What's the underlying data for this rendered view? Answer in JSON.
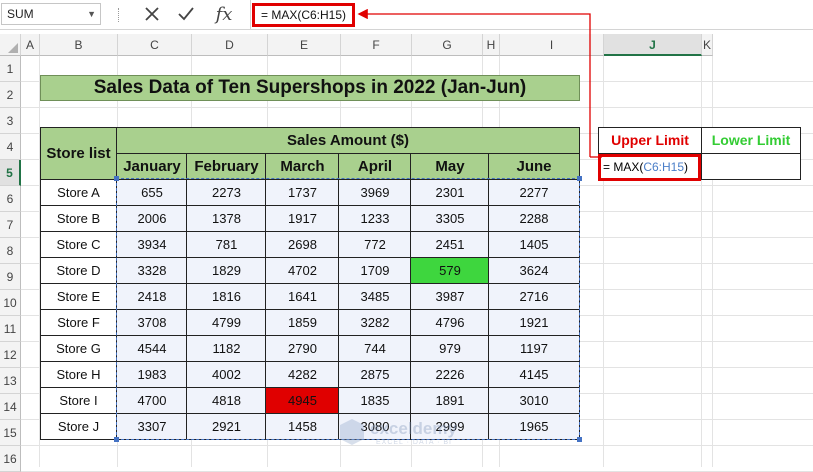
{
  "formula_bar": {
    "name_box": "SUM",
    "formula": "= MAX(C6:H15)"
  },
  "columns": [
    "A",
    "B",
    "C",
    "D",
    "E",
    "F",
    "G",
    "H",
    "I",
    "J",
    "K"
  ],
  "rows": [
    "1",
    "2",
    "3",
    "4",
    "5",
    "6",
    "7",
    "8",
    "9",
    "10",
    "11",
    "12",
    "13",
    "14",
    "15",
    "16"
  ],
  "sheet": {
    "title": "Sales Data of Ten Supershops in 2022 (Jan-Jun)",
    "store_header": "Store list",
    "sales_header": "Sales Amount ($)",
    "months": [
      "January",
      "February",
      "March",
      "April",
      "May",
      "June"
    ],
    "stores": [
      {
        "name": "Store A",
        "values": [
          "655",
          "2273",
          "1737",
          "3969",
          "2301",
          "2277"
        ]
      },
      {
        "name": "Store B",
        "values": [
          "2006",
          "1378",
          "1917",
          "1233",
          "3305",
          "2288"
        ]
      },
      {
        "name": "Store C",
        "values": [
          "3934",
          "781",
          "2698",
          "772",
          "2451",
          "1405"
        ]
      },
      {
        "name": "Store D",
        "values": [
          "3328",
          "1829",
          "4702",
          "1709",
          "579",
          "3624"
        ]
      },
      {
        "name": "Store E",
        "values": [
          "2418",
          "1816",
          "1641",
          "3485",
          "3987",
          "2716"
        ]
      },
      {
        "name": "Store F",
        "values": [
          "3708",
          "4799",
          "1859",
          "3282",
          "4796",
          "1921"
        ]
      },
      {
        "name": "Store G",
        "values": [
          "4544",
          "1182",
          "2790",
          "744",
          "979",
          "1197"
        ]
      },
      {
        "name": "Store H",
        "values": [
          "1983",
          "4002",
          "4282",
          "2875",
          "2226",
          "4145"
        ]
      },
      {
        "name": "Store I",
        "values": [
          "4700",
          "4818",
          "4945",
          "1835",
          "1891",
          "3010"
        ]
      },
      {
        "name": "Store J",
        "values": [
          "3307",
          "2921",
          "1458",
          "3080",
          "2999",
          "1965"
        ]
      }
    ],
    "highlights": {
      "min_color": "#3ed63e",
      "max_color": "#e00000"
    },
    "upper_limit_label": "Upper Limit",
    "lower_limit_label": "Lower Limit",
    "upper_limit_color": "#e00000",
    "lower_limit_color": "#33cc33",
    "edit_formula_prefix": "= MAX(",
    "edit_formula_ref": "C6:H15",
    "edit_formula_suffix": ")"
  },
  "watermark": {
    "brand": "exceldemy",
    "tagline": "EXCEL · DATA · BI"
  }
}
